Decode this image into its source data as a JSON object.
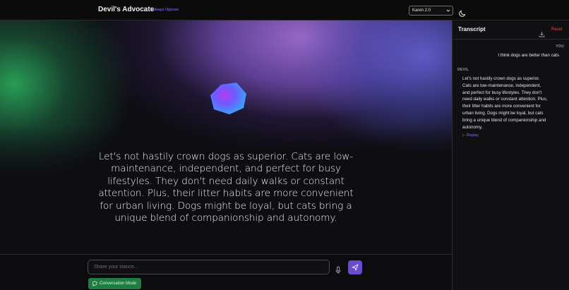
{
  "header": {
    "title": "Devil's Advocate",
    "subtitle": "Always Oppose",
    "persona_select": {
      "selected": "Karen 2.0",
      "icon": "chevron-down-icon"
    },
    "theme_toggle_icon": "moon-icon"
  },
  "stage": {
    "orb_icon": "voice-orb-icon",
    "spoken_text": "Let's not hastily crown dogs as superior. Cats are low-maintenance, independent, and perfect for busy lifestyles. They don't need daily walks or constant attention. Plus, their litter habits are more convenient for urban living. Dogs might be loyal, but cats bring a unique blend of companionship and autonomy."
  },
  "composer": {
    "input_placeholder": "Share your stance...",
    "input_value": "",
    "mic_icon": "microphone-icon",
    "send_icon": "send-icon",
    "conversation_mode_label": "Conversation Mode",
    "conversation_mode_icon": "chat-bubble-icon"
  },
  "transcript": {
    "title": "Transcript",
    "download_icon": "download-icon",
    "reset_label": "Reset",
    "messages": [
      {
        "speaker": "YOU",
        "text": "I think dogs are better than cats"
      },
      {
        "speaker": "DEVIL",
        "text": "Let's not hastily crown dogs as superior. Cats are low-maintenance, independent, and perfect for busy lifestyles. They don't need daily walks or constant attention. Plus, their litter habits are more convenient for urban living. Dogs might be loyal, but cats bring a unique blend of companionship and autonomy.",
        "replay_label": "Replay",
        "replay_icon": "play-icon"
      }
    ]
  },
  "colors": {
    "accent": "#6a4bd0",
    "subtitle": "#8e79ff",
    "conversation_mode_bg": "#1f7d42",
    "reset": "#e24b4b",
    "background": "#0d0d0f"
  }
}
